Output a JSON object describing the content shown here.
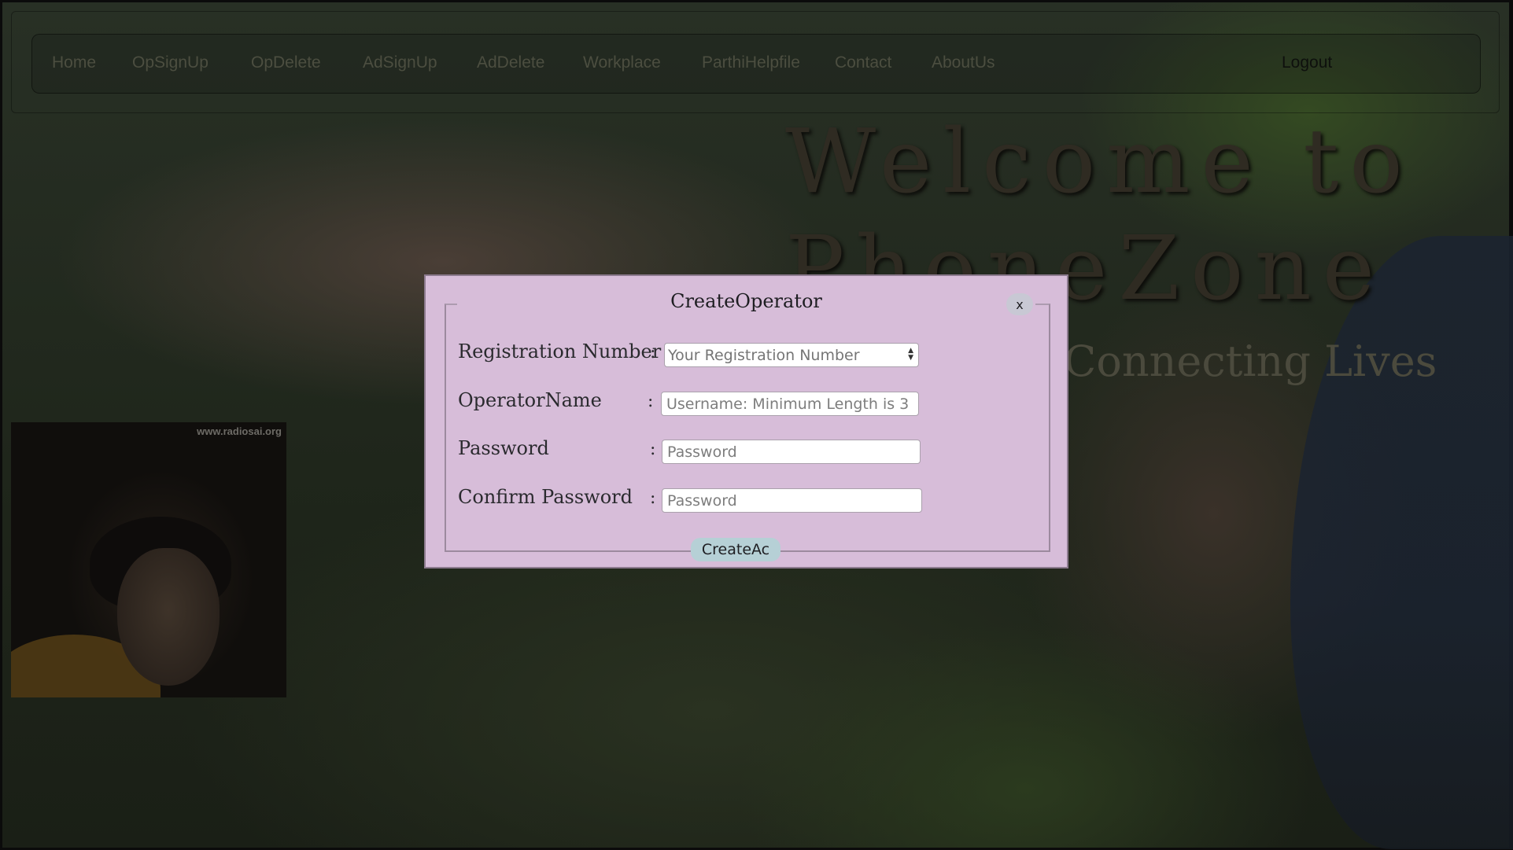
{
  "nav": {
    "items": [
      "Home",
      "OpSignUp",
      "OpDelete",
      "AdSignUp",
      "AdDelete",
      "Workplace",
      "ParthiHelpfile",
      "Contact",
      "AboutUs"
    ],
    "logout": "Logout"
  },
  "hero": {
    "welcome_line1": "Welcome to",
    "welcome_line2": "PhoneZone",
    "tagline": "Connecting Lives"
  },
  "photo": {
    "watermark": "www.radiosai.org"
  },
  "modal": {
    "title": "CreateOperator",
    "close_label": "x",
    "fields": [
      {
        "label": "Registration Number",
        "placeholder": "Your Registration Number",
        "type": "number"
      },
      {
        "label": "OperatorName",
        "placeholder": "Username: Minimum Length is 3",
        "type": "text"
      },
      {
        "label": "Password",
        "placeholder": "Password",
        "type": "password"
      },
      {
        "label": "Confirm Password",
        "placeholder": "Password",
        "type": "password"
      }
    ],
    "colon": ":",
    "submit_label": "CreateAc"
  },
  "colors": {
    "modal_bg": "#d7bdd9",
    "submit_bg": "#b6d0d6",
    "close_bg": "#c8c8d4"
  }
}
